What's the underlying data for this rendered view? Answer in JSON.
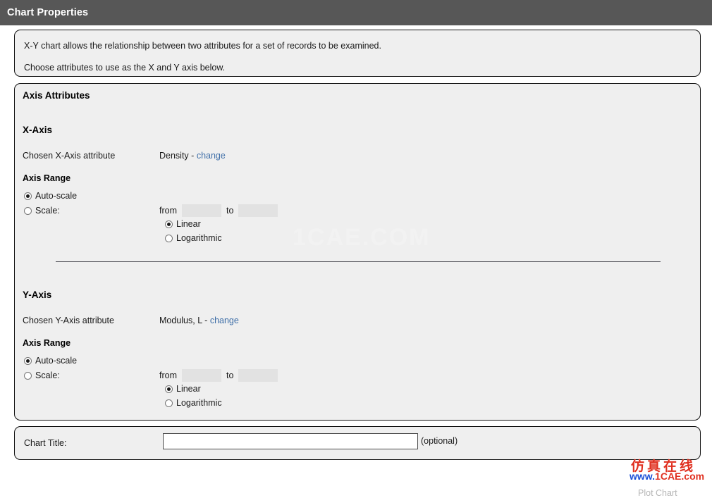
{
  "window": {
    "title": "Chart Properties"
  },
  "description": {
    "line1": "X-Y chart allows the relationship between two attributes for a set of records to be examined.",
    "line2": "Choose attributes to use as the X and Y axis below."
  },
  "axis_attributes": {
    "heading": "Axis Attributes",
    "x_axis": {
      "heading": "X-Axis",
      "chosen_label": "Chosen X-Axis attribute",
      "chosen_value": "Density",
      "separator": "-",
      "change_link": "change",
      "range_heading": "Axis Range",
      "auto_scale_label": "Auto-scale",
      "auto_scale_selected": true,
      "scale_label": "Scale:",
      "scale_selected": false,
      "from_word": "from",
      "from_value": "",
      "to_word": "to",
      "to_value": "",
      "linear_label": "Linear",
      "linear_selected": true,
      "logarithmic_label": "Logarithmic",
      "logarithmic_selected": false
    },
    "y_axis": {
      "heading": "Y-Axis",
      "chosen_label": "Chosen Y-Axis attribute",
      "chosen_value": "Modulus, L",
      "separator": "-",
      "change_link": "change",
      "range_heading": "Axis Range",
      "auto_scale_label": "Auto-scale",
      "auto_scale_selected": true,
      "scale_label": "Scale:",
      "scale_selected": false,
      "from_word": "from",
      "from_value": "",
      "to_word": "to",
      "to_value": "",
      "linear_label": "Linear",
      "linear_selected": true,
      "logarithmic_label": "Logarithmic",
      "logarithmic_selected": false
    }
  },
  "chart_title": {
    "label": "Chart Title:",
    "value": "",
    "optional_note": "(optional)"
  },
  "actions": {
    "plot_chart_label": "Plot Chart"
  },
  "watermarks": {
    "center": "1CAE.COM",
    "chinese": "仿真在线",
    "url_prefix": "www.",
    "url_suffix": "1CAE.com"
  },
  "colors": {
    "titlebar": "#575757",
    "panel_bg": "#efefef",
    "panel_border": "#111111",
    "link": "#3f6fa8",
    "page_bg": "#ffffff"
  }
}
